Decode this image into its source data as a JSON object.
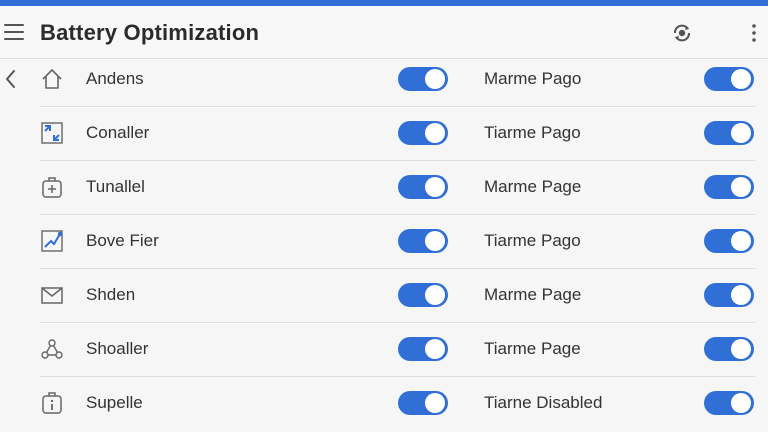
{
  "header": {
    "title": "Battery Optimization",
    "menu_icon": "hamburger-menu-icon",
    "sync_icon": "sync-icon",
    "more_icon": "more-vert-icon",
    "back_icon": "chevron-left-icon"
  },
  "colors": {
    "accent": "#2f6fd6",
    "icon_blue": "#2f6fd6"
  },
  "apps": [
    {
      "name": "Andens",
      "icon": "home-icon",
      "toggle_on": true,
      "sub_label": "Marme Pago",
      "sub_toggle_on": true
    },
    {
      "name": "Conaller",
      "icon": "resize-icon",
      "toggle_on": true,
      "sub_label": "Tiarme Pago",
      "sub_toggle_on": true
    },
    {
      "name": "Tunallel",
      "icon": "medkit-icon",
      "toggle_on": true,
      "sub_label": "Marme Page",
      "sub_toggle_on": true
    },
    {
      "name": "Bove Fier",
      "icon": "chart-icon",
      "toggle_on": true,
      "sub_label": "Tiarme Pago",
      "sub_toggle_on": true
    },
    {
      "name": "Shden",
      "icon": "mail-icon",
      "toggle_on": true,
      "sub_label": "Marme Page",
      "sub_toggle_on": true
    },
    {
      "name": "Shoaller",
      "icon": "share-icon",
      "toggle_on": true,
      "sub_label": "Tiarme Page",
      "sub_toggle_on": true
    },
    {
      "name": "Supelle",
      "icon": "info-icon",
      "toggle_on": true,
      "sub_label": "Tiarne Disabled",
      "sub_toggle_on": true
    }
  ]
}
